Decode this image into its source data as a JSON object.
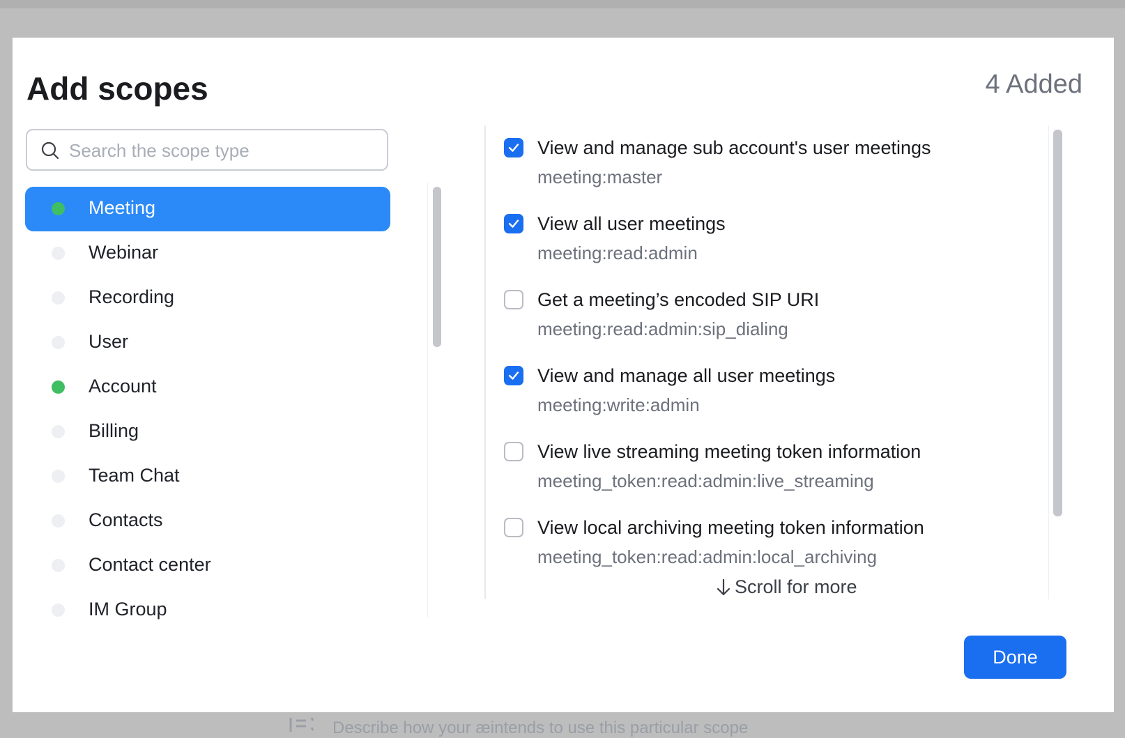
{
  "background": {
    "hint_text": "Describe how your æintends to use this particular scope"
  },
  "modal": {
    "title": "Add scopes",
    "added_count": "4 Added",
    "search": {
      "placeholder": "Search the scope type",
      "value": ""
    },
    "categories": [
      {
        "label": "Meeting",
        "has_selection": true,
        "active": true
      },
      {
        "label": "Webinar",
        "has_selection": false,
        "active": false
      },
      {
        "label": "Recording",
        "has_selection": false,
        "active": false
      },
      {
        "label": "User",
        "has_selection": false,
        "active": false
      },
      {
        "label": "Account",
        "has_selection": true,
        "active": false
      },
      {
        "label": "Billing",
        "has_selection": false,
        "active": false
      },
      {
        "label": "Team Chat",
        "has_selection": false,
        "active": false
      },
      {
        "label": "Contacts",
        "has_selection": false,
        "active": false
      },
      {
        "label": "Contact center",
        "has_selection": false,
        "active": false
      },
      {
        "label": "IM Group",
        "has_selection": false,
        "active": false
      }
    ],
    "scopes": [
      {
        "name": "View and manage sub account's user meetings",
        "code": "meeting:master",
        "checked": true
      },
      {
        "name": "View all user meetings",
        "code": "meeting:read:admin",
        "checked": true
      },
      {
        "name": "Get a meeting’s encoded SIP URI",
        "code": "meeting:read:admin:sip_dialing",
        "checked": false
      },
      {
        "name": "View and manage all user meetings",
        "code": "meeting:write:admin",
        "checked": true
      },
      {
        "name": "View live streaming meeting token information",
        "code": "meeting_token:read:admin:live_streaming",
        "checked": false
      },
      {
        "name": "View local archiving meeting token information",
        "code": "meeting_token:read:admin:local_archiving",
        "checked": false
      }
    ],
    "scroll_hint": "Scroll for more",
    "done_label": "Done"
  },
  "colors": {
    "accent": "#1a6ef0",
    "active_category": "#2b8af7",
    "selected_dot": "#3fbe63",
    "muted_text": "#6d717c"
  }
}
